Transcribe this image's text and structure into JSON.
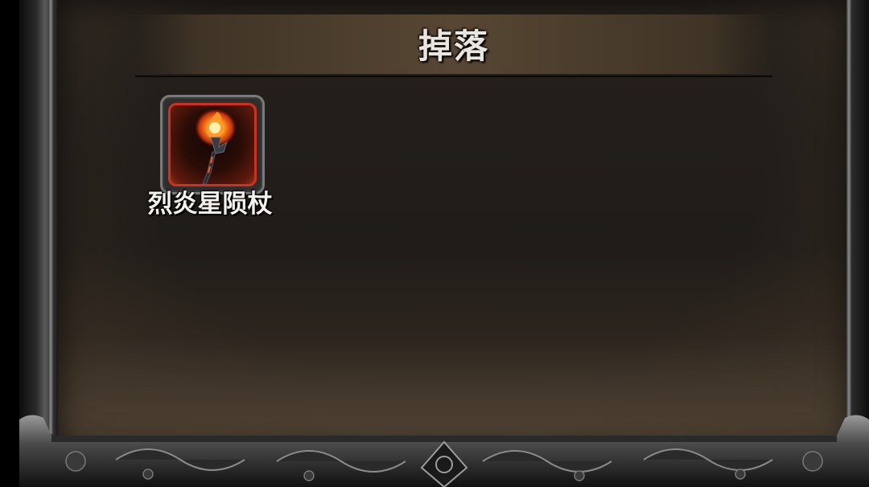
{
  "panel": {
    "title": "掉落"
  },
  "drops": [
    {
      "name": "烈炎星陨杖",
      "icon": "fire-staff-icon",
      "rarity_color": "#d0301c"
    }
  ],
  "colors": {
    "background": "#1f1b17",
    "banner": "#574633",
    "text": "#f4f1ea",
    "rarity_border": "#d0301c"
  }
}
